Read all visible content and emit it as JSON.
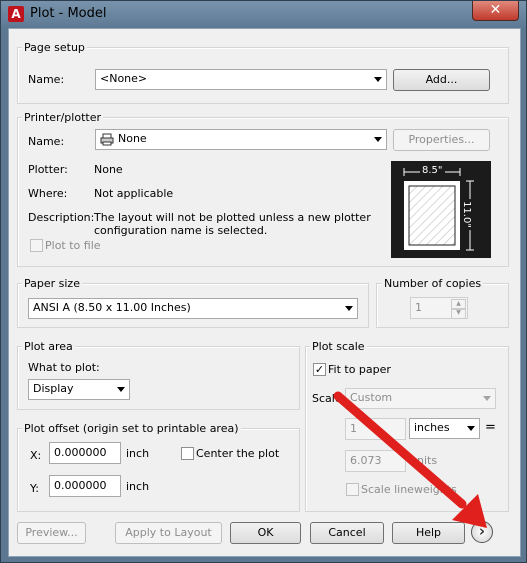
{
  "window": {
    "title": "Plot - Model",
    "app_icon": "A",
    "close_glyph": "✕"
  },
  "page_setup": {
    "group_label": "Page setup",
    "name_label": "Name:",
    "name_value": "<None>",
    "add_button": "Add..."
  },
  "printer": {
    "group_label": "Printer/plotter",
    "name_label": "Name:",
    "name_value": "None",
    "properties_button": "Properties...",
    "plotter_label": "Plotter:",
    "plotter_value": "None",
    "where_label": "Where:",
    "where_value": "Not applicable",
    "description_label": "Description:",
    "description_line1": "The layout will not be plotted unless a new plotter",
    "description_line2": "configuration name is selected.",
    "plot_to_file_label": "Plot to file",
    "preview_width": "8.5\"",
    "preview_height": "11.0\""
  },
  "paper_size": {
    "group_label": "Paper size",
    "value": "ANSI A (8.50 x 11.00 Inches)"
  },
  "copies": {
    "group_label": "Number of copies",
    "value": "1"
  },
  "plot_area": {
    "group_label": "Plot area",
    "what_label": "What to plot:",
    "value": "Display"
  },
  "plot_scale": {
    "group_label": "Plot scale",
    "fit_label": "Fit to paper",
    "fit_checked": true,
    "scale_label": "Scale:",
    "scale_value": "Custom",
    "value1": "1",
    "unit": "inches",
    "equals": "=",
    "value2": "6.073",
    "units_label": "units",
    "lineweights_label": "Scale lineweights"
  },
  "plot_offset": {
    "group_label": "Plot offset (origin set to printable area)",
    "x_label": "X:",
    "x_value": "0.000000",
    "x_unit": "inch",
    "y_label": "Y:",
    "y_value": "0.000000",
    "y_unit": "inch",
    "center_label": "Center the plot"
  },
  "buttons": {
    "preview": "Preview...",
    "apply": "Apply to Layout",
    "ok": "OK",
    "cancel": "Cancel",
    "help": "Help",
    "more": "›"
  },
  "colors": {
    "frame": "#5c7890",
    "annotation_arrow": "#e0201c"
  }
}
